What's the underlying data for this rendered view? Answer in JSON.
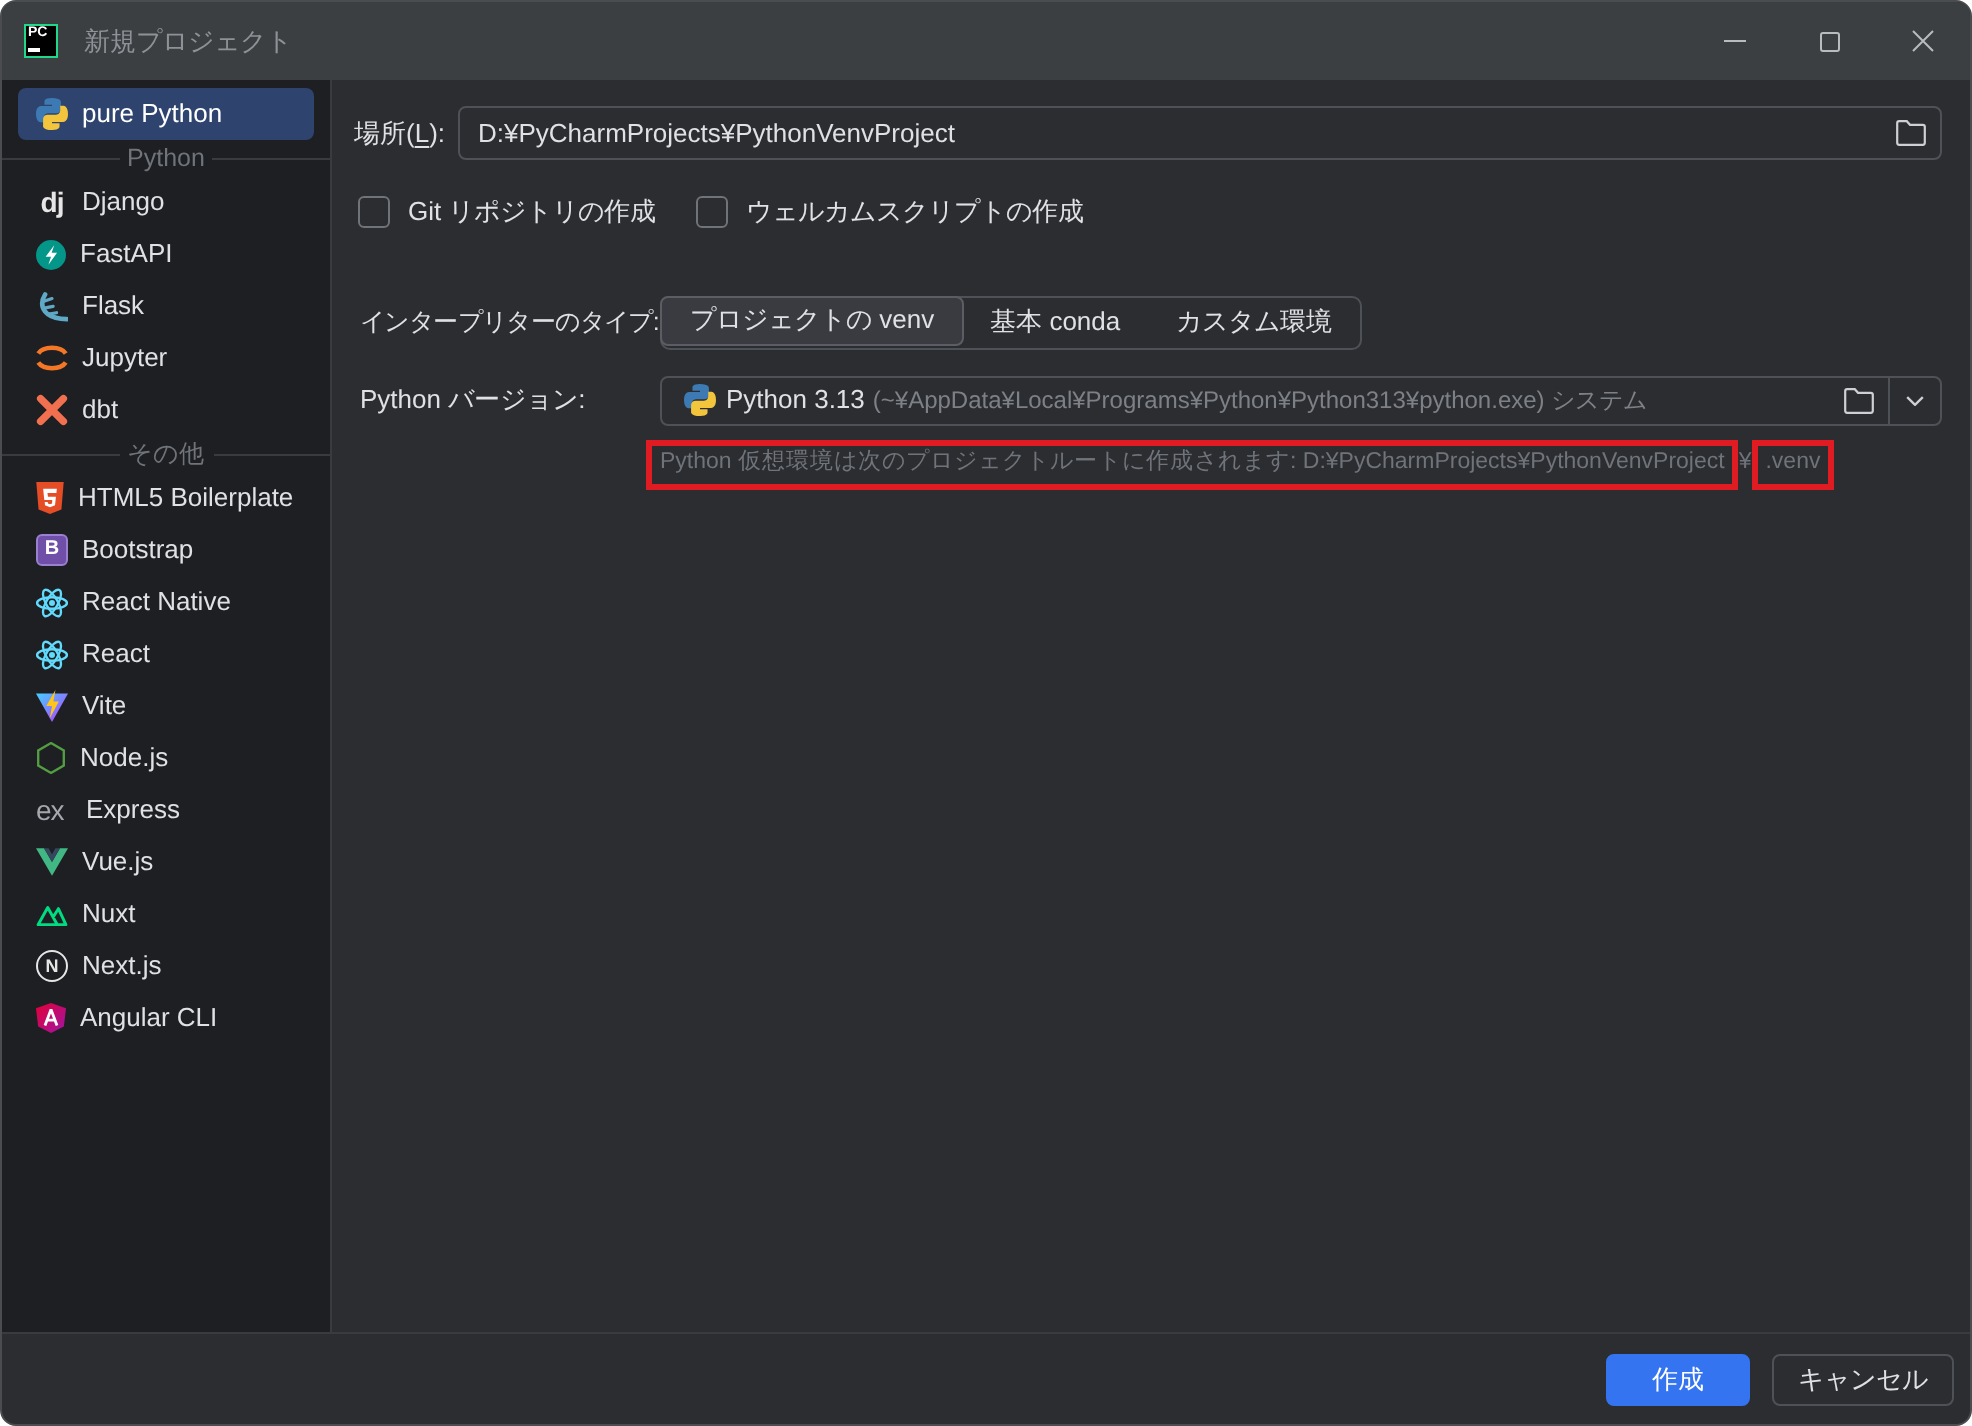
{
  "window": {
    "app_icon_text": "PC",
    "title": "新規プロジェクト"
  },
  "sidebar": {
    "groups": [
      {
        "items": [
          {
            "label": "pure Python",
            "selected": true
          }
        ]
      },
      {
        "header": "Python",
        "items": [
          {
            "label": "Django",
            "selected": false,
            "icon_text": "dj"
          },
          {
            "label": "FastAPI",
            "selected": false
          },
          {
            "label": "Flask",
            "selected": false
          },
          {
            "label": "Jupyter",
            "selected": false
          },
          {
            "label": "dbt",
            "selected": false
          }
        ]
      },
      {
        "header": "その他",
        "items": [
          {
            "label": "HTML5 Boilerplate",
            "selected": false
          },
          {
            "label": "Bootstrap",
            "selected": false,
            "icon_text": "B"
          },
          {
            "label": "React Native",
            "selected": false
          },
          {
            "label": "React",
            "selected": false
          },
          {
            "label": "Vite",
            "selected": false
          },
          {
            "label": "Node.js",
            "selected": false
          },
          {
            "label": "Express",
            "selected": false,
            "icon_text": "ex"
          },
          {
            "label": "Vue.js",
            "selected": false
          },
          {
            "label": "Nuxt",
            "selected": false
          },
          {
            "label": "Next.js",
            "selected": false,
            "icon_text": "N"
          },
          {
            "label": "Angular CLI",
            "selected": false
          }
        ]
      }
    ]
  },
  "location": {
    "label_parts": [
      {
        "text": "場所(",
        "underlined": false
      },
      {
        "text": "L",
        "underlined": true
      },
      {
        "text": "):",
        "underlined": false
      }
    ],
    "value": "D:¥PyCharmProjects¥PythonVenvProject"
  },
  "checkboxes": [
    {
      "label": "Git リポジトリの作成",
      "checked": false
    },
    {
      "label": "ウェルカムスクリプトの作成",
      "checked": false
    }
  ],
  "interpreter_type": {
    "label": "インタープリターのタイプ:",
    "options": [
      {
        "label": "プロジェクトの venv",
        "selected": true
      },
      {
        "label": "基本 conda",
        "selected": false
      },
      {
        "label": "カスタム環境",
        "selected": false
      }
    ]
  },
  "python_version": {
    "label": "Python バージョン:",
    "version": "Python 3.13",
    "path": "(~¥AppData¥Local¥Programs¥Python¥Python313¥python.exe) システム"
  },
  "hint": [
    {
      "text": "Python 仮想環境は次のプロジェクトルートに作成されます: D:¥PyCharmProjects¥PythonVenvProject",
      "highlighted": true
    },
    {
      "text": "¥",
      "highlighted": false
    },
    {
      "text": ".venv",
      "highlighted": true
    }
  ],
  "buttons": [
    {
      "label": "作成",
      "kind": "primary"
    },
    {
      "label": "キャンセル",
      "kind": "secondary"
    }
  ]
}
